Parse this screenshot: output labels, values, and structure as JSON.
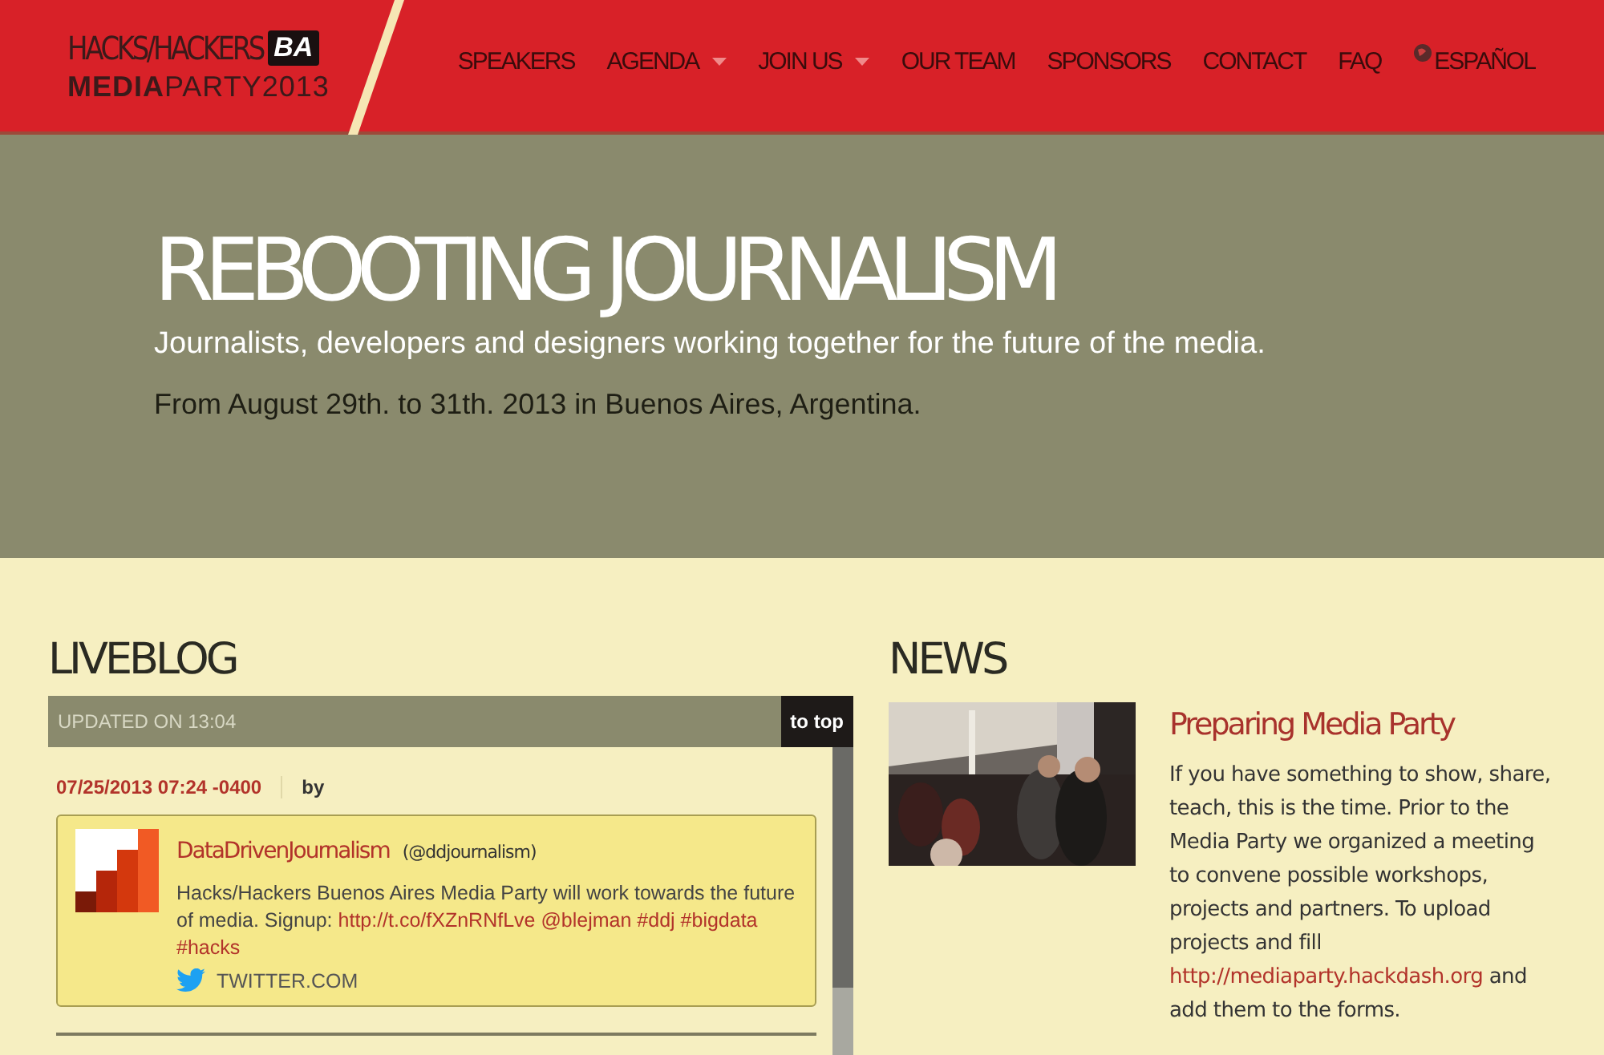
{
  "logo": {
    "line1": "HACKS/HACKERS",
    "badge": "BA",
    "line2_bold": "MEDIA",
    "line2_light": "PARTY2013"
  },
  "nav": [
    {
      "label": "SPEAKERS",
      "dropdown": false,
      "kind": "link"
    },
    {
      "label": "AGENDA",
      "dropdown": true,
      "kind": "link"
    },
    {
      "label": "JOIN US",
      "dropdown": true,
      "kind": "link"
    },
    {
      "label": "OUR TEAM",
      "dropdown": false,
      "kind": "link"
    },
    {
      "label": "SPONSORS",
      "dropdown": false,
      "kind": "link"
    },
    {
      "label": "CONTACT",
      "dropdown": false,
      "kind": "link"
    },
    {
      "label": "FAQ",
      "dropdown": false,
      "kind": "link"
    },
    {
      "label": "ESPAÑOL",
      "kind": "language"
    }
  ],
  "hero": {
    "title": "REBOOTING JOURNALISM",
    "subtitle": "Journalists, developers and designers working together for the future of the media.",
    "dates": "From August 29th. to 31th. 2013 in Buenos Aires, Argentina."
  },
  "liveblog": {
    "heading": "LIVEBLOG",
    "updated": "UPDATED ON 13:04",
    "to_top": "to top",
    "entries": [
      {
        "timestamp": "07/25/2013 07:24 -0400",
        "by": "by",
        "tweet": {
          "author": "DataDrivenJournalism",
          "handle": "(@ddjournalism)",
          "segments": [
            {
              "kind": "text",
              "text": "Hacks/Hackers Buenos Aires Media Party will work towards the future of media. Signup: "
            },
            {
              "kind": "link",
              "text": "http://t.co/fXZnRNfLve"
            },
            {
              "kind": "link",
              "text": "@blejman"
            },
            {
              "kind": "link",
              "text": "#ddj"
            },
            {
              "kind": "link",
              "text": "#bigdata"
            },
            {
              "kind": "link",
              "text": "#hacks"
            }
          ],
          "source": "TWITTER.COM"
        }
      }
    ]
  },
  "news": {
    "heading": "NEWS",
    "items": [
      {
        "title": "Preparing Media Party",
        "segments": [
          {
            "kind": "text",
            "text": "If you have something to show, share, teach, this is the time. Prior to the Media Party we organized a meeting to convene possible workshops, projects and partners. To upload projects and fill "
          },
          {
            "kind": "link",
            "text": "http://mediaparty.hackdash.org"
          },
          {
            "kind": "text",
            "text": " and add them to the forms."
          }
        ]
      }
    ]
  }
}
